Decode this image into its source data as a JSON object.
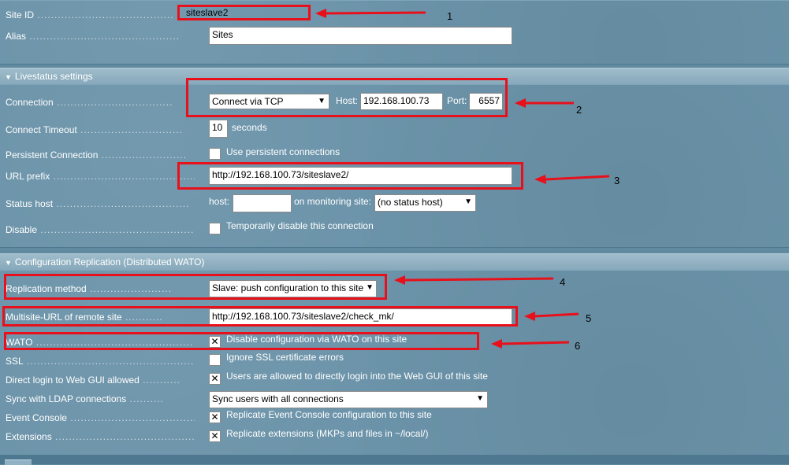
{
  "top": {
    "site_id_label": "Site ID",
    "site_id_value": "siteslave2",
    "alias_label": "Alias",
    "alias_value": "Sites"
  },
  "livestatus": {
    "header": "Livestatus settings",
    "connection_label": "Connection",
    "connection_select": "Connect via TCP",
    "host_label": "Host:",
    "host_value": "192.168.100.73",
    "port_label": "Port:",
    "port_value": "6557",
    "timeout_label": "Connect Timeout",
    "timeout_value": "10",
    "timeout_unit": "seconds",
    "persistent_label": "Persistent Connection",
    "persistent_text": "Use persistent connections",
    "persistent_checked": false,
    "url_prefix_label": "URL prefix",
    "url_prefix_value": "http://192.168.100.73/siteslave2/",
    "status_host_label": "Status host",
    "status_host_host_label": "host:",
    "status_host_host_value": "",
    "status_host_site_label": "on monitoring site:",
    "status_host_site_select": "(no status host)",
    "disable_label": "Disable",
    "disable_text": "Temporarily disable this connection",
    "disable_checked": false
  },
  "replication": {
    "header": "Configuration Replication (Distributed WATO)",
    "method_label": "Replication method",
    "method_select": "Slave: push configuration to this site",
    "multisite_label": "Multisite-URL of remote site",
    "multisite_value": "http://192.168.100.73/siteslave2/check_mk/",
    "wato_label": "WATO",
    "wato_text": "Disable configuration via WATO on this site",
    "wato_checked": true,
    "ssl_label": "SSL",
    "ssl_text": "Ignore SSL certificate errors",
    "ssl_checked": false,
    "direct_login_label": "Direct login to Web GUI allowed",
    "direct_login_text": "Users are allowed to directly login into the Web GUI of this site",
    "direct_login_checked": true,
    "ldap_label": "Sync with LDAP connections",
    "ldap_select": "Sync users with all connections",
    "event_console_label": "Event Console",
    "event_console_text": "Replicate Event Console configuration to this site",
    "event_console_checked": true,
    "extensions_label": "Extensions",
    "extensions_text": "Replicate extensions (MKPs and files in ~/local/)",
    "extensions_checked": true
  },
  "annotations": {
    "n1": "1",
    "n2": "2",
    "n3": "3",
    "n4": "4",
    "n5": "5",
    "n6": "6",
    "highlight_color": "#e8101b"
  },
  "icons": {
    "section_toggle": "triangle-down-icon",
    "checkbox_checked": "check-x-icon",
    "dropdown": "chevron-down-icon"
  }
}
